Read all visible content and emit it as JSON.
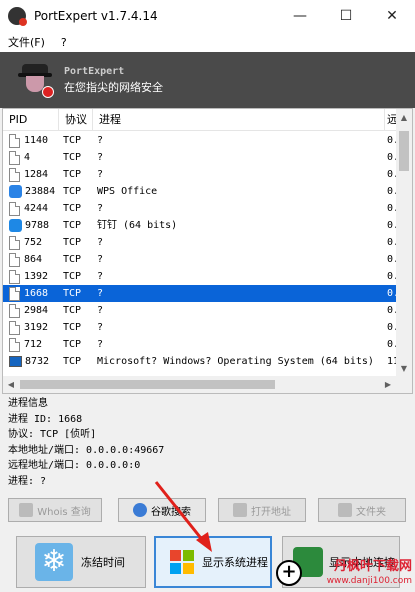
{
  "window": {
    "title": "PortExpert v1.7.4.14",
    "minimize": "—",
    "maximize": "☐",
    "close": "✕"
  },
  "menu": [
    {
      "label": "文件(F)"
    },
    {
      "label": "?"
    }
  ],
  "banner": {
    "app_name": "PortExpert",
    "slogan": "在您指尖的网络安全"
  },
  "table": {
    "columns": [
      "PID",
      "协议",
      "进程",
      "远"
    ],
    "rows": [
      {
        "pid": "1140",
        "proto": "TCP",
        "process": "?",
        "remote": "0.",
        "icon": "file-icon"
      },
      {
        "pid": "4",
        "proto": "TCP",
        "process": "?",
        "remote": "0.",
        "icon": "file-icon"
      },
      {
        "pid": "1284",
        "proto": "TCP",
        "process": "?",
        "remote": "0.",
        "icon": "file-icon"
      },
      {
        "pid": "23884",
        "proto": "TCP",
        "process": "WPS Office",
        "remote": "0.",
        "icon": "wps-icon"
      },
      {
        "pid": "4244",
        "proto": "TCP",
        "process": "?",
        "remote": "0.",
        "icon": "file-icon"
      },
      {
        "pid": "9788",
        "proto": "TCP",
        "process": "钉钉 (64 bits)",
        "remote": "0.",
        "icon": "dingtalk-icon"
      },
      {
        "pid": "752",
        "proto": "TCP",
        "process": "?",
        "remote": "0.",
        "icon": "file-icon"
      },
      {
        "pid": "864",
        "proto": "TCP",
        "process": "?",
        "remote": "0.",
        "icon": "file-icon"
      },
      {
        "pid": "1392",
        "proto": "TCP",
        "process": "?",
        "remote": "0.",
        "icon": "file-icon"
      },
      {
        "pid": "1668",
        "proto": "TCP",
        "process": "?",
        "remote": "0.",
        "icon": "file-icon",
        "selected": true
      },
      {
        "pid": "2984",
        "proto": "TCP",
        "process": "?",
        "remote": "0.",
        "icon": "file-icon"
      },
      {
        "pid": "3192",
        "proto": "TCP",
        "process": "?",
        "remote": "0.",
        "icon": "file-icon"
      },
      {
        "pid": "712",
        "proto": "TCP",
        "process": "?",
        "remote": "0.",
        "icon": "file-icon"
      },
      {
        "pid": "8732",
        "proto": "TCP",
        "process": "Microsoft? Windows? Operating System (64 bits)",
        "remote": "11",
        "icon": "system-icon"
      }
    ]
  },
  "info": {
    "header": "进程信息",
    "pid_line": "进程 ID: 1668",
    "proto_line": "协议: TCP [侦听]",
    "local_line": "本地地址/端口: 0.0.0.0:49667",
    "remote_line": "远程地址/端口: 0.0.0.0:0",
    "process_line": "进程: ?"
  },
  "small_buttons": {
    "whois": "Whois 查询",
    "google": "谷歌搜索",
    "open_addr": "打开地址",
    "folder": "文件夹"
  },
  "big_buttons": {
    "freeze": "冻结时间",
    "show_system": "显示系统进程",
    "network": "显示本地连接"
  },
  "watermark": {
    "line1": "丹枫叶下载网",
    "line2": "www.danji100.com"
  }
}
